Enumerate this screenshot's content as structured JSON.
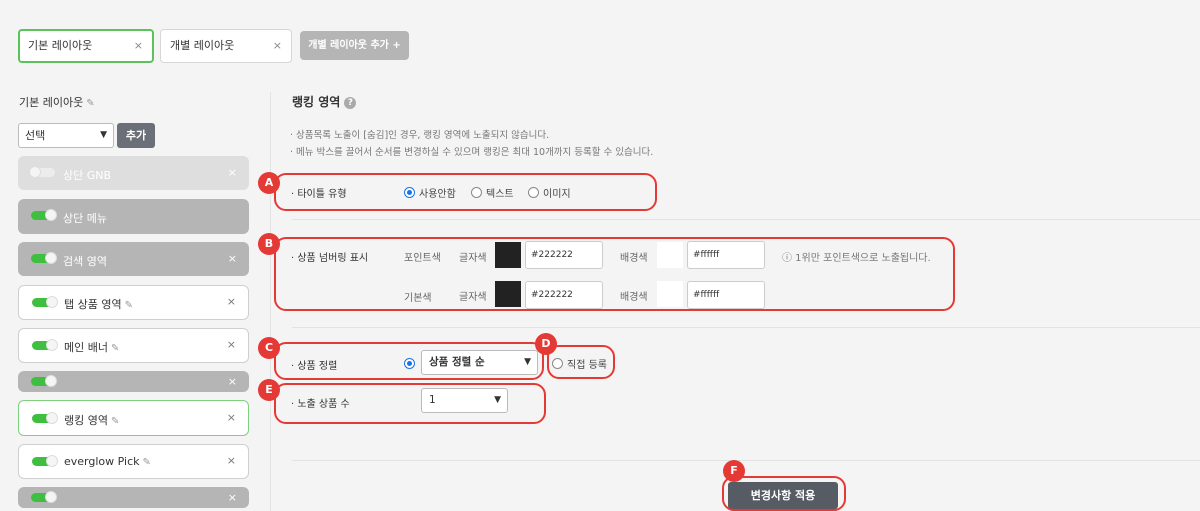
{
  "tabs": [
    {
      "label": "기본 레이아웃",
      "close": "×"
    },
    {
      "label": "개별 레이아웃",
      "close": "×"
    }
  ],
  "add_tab_label": "개별 레이아웃 추가 +",
  "left": {
    "title": "기본 레이아웃",
    "pencil": "✎",
    "select_value": "선택",
    "add_button": "추가",
    "items": [
      {
        "label": "상단 GNB",
        "x": "×"
      },
      {
        "label": "상단 메뉴",
        "x": ""
      },
      {
        "label": "검색 영역",
        "x": "×"
      },
      {
        "label": "탭 상품 영역",
        "x": "×"
      },
      {
        "label": "메인 배너",
        "x": "×"
      },
      {
        "label": "",
        "x": "×"
      },
      {
        "label": "랭킹 영역",
        "x": "×"
      },
      {
        "label": "everglow Pick",
        "x": "×"
      },
      {
        "label": "",
        "x": "×"
      }
    ]
  },
  "section": {
    "title": "랭킹 영역",
    "help": "?",
    "notes": [
      "· 상품목록 노출이 [숨김]인 경우, 랭킹 영역에 노출되지 않습니다.",
      "· 메뉴 박스를 끌어서 순서를 변경하실 수 있으며 랭킹은 최대 10개까지 등록할 수 있습니다."
    ],
    "title_type": {
      "label": "· 타이틀 유형",
      "options": [
        "사용안함",
        "텍스트",
        "이미지"
      ],
      "selected": "사용안함"
    },
    "numbering": {
      "label": "· 상품 넘버링 표시",
      "point_color": "포인트색",
      "base_color": "기본색",
      "text_color": "글자색",
      "bg_color": "배경색",
      "point_text_hex": "#222222",
      "point_bg_hex": "#ffffff",
      "base_text_hex": "#222222",
      "base_bg_hex": "#ffffff",
      "info": "ⓘ 1위만 포인트색으로 노출됩니다."
    },
    "sort": {
      "label": "· 상품 정렬",
      "dropdown_value": "상품 정렬 순",
      "manual": "직접 등록"
    },
    "count": {
      "label": "· 노출 상품 수",
      "value": "1"
    },
    "apply_button": "변경사항 적용"
  },
  "badges": [
    "A",
    "B",
    "C",
    "D",
    "E",
    "F"
  ],
  "colors": {
    "accent": "#e53935",
    "green": "#3fbf3f",
    "radio": "#1a73e8",
    "dark_swatch": "#222222"
  }
}
